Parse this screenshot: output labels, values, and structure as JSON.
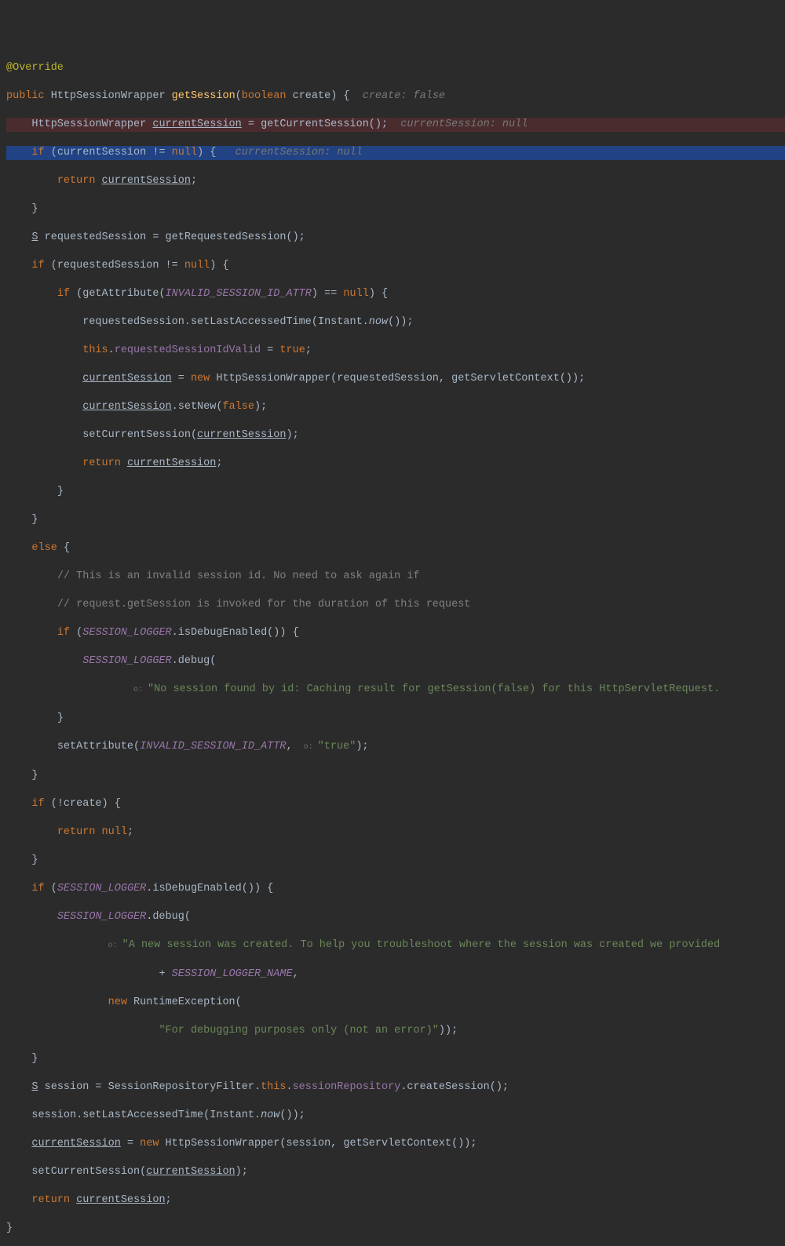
{
  "code": {
    "l1": {
      "anno": "@Override"
    },
    "l2": {
      "kw1": "public ",
      "type": "HttpSessionWrapper ",
      "method": "getSession",
      "p1": "(",
      "kw2": "boolean ",
      "p2": "create) {",
      "hint": "  create: false"
    },
    "l3": {
      "indent": "    ",
      "t1": "HttpSessionWrapper ",
      "u1": "currentSession",
      "t2": " = getCurrentSession();",
      "hint": "  currentSession: null"
    },
    "l4": {
      "indent": "    ",
      "kw": "if ",
      "t1": "(currentSession != ",
      "kw2": "null",
      "t2": ") {",
      "hint": "   currentSession: null"
    },
    "l5": {
      "indent": "        ",
      "kw": "return ",
      "u": "currentSession",
      "t": ";"
    },
    "l6": {
      "indent": "    ",
      "t": "}"
    },
    "l7": {
      "indent": "    ",
      "u1": "S",
      "t1": " requestedSession = getRequestedSession();"
    },
    "l8": {
      "indent": "    ",
      "kw": "if ",
      "t": "(requestedSession != ",
      "kw2": "null",
      "t2": ") {"
    },
    "l9": {
      "indent": "        ",
      "kw": "if ",
      "t1": "(getAttribute(",
      "c": "INVALID_SESSION_ID_ATTR",
      "t2": ") == ",
      "kw2": "null",
      "t3": ") {"
    },
    "l10": {
      "indent": "            ",
      "t1": "requestedSession.setLastAccessedTime(Instant.",
      "i": "now",
      "t2": "());"
    },
    "l11": {
      "indent": "            ",
      "kw": "this",
      "t1": ".",
      "f": "requestedSessionIdValid",
      "t2": " = ",
      "kw2": "true",
      "t3": ";"
    },
    "l12": {
      "indent": "            ",
      "u": "currentSession",
      "t1": " = ",
      "kw": "new ",
      "t2": "HttpSessionWrapper(requestedSession, getServletContext());"
    },
    "l13": {
      "indent": "            ",
      "u": "currentSession",
      "t1": ".setNew(",
      "kw": "false",
      "t2": ");"
    },
    "l14": {
      "indent": "            ",
      "t1": "setCurrentSession(",
      "u": "currentSession",
      "t2": ");"
    },
    "l15": {
      "indent": "            ",
      "kw": "return ",
      "u": "currentSession",
      "t": ";"
    },
    "l16": {
      "indent": "        ",
      "t": "}"
    },
    "l17": {
      "indent": "    ",
      "t": "}"
    },
    "l18": {
      "indent": "    ",
      "kw": "else ",
      "t": "{"
    },
    "l19": {
      "indent": "        ",
      "c": "// This is an invalid session id. No need to ask again if"
    },
    "l20": {
      "indent": "        ",
      "c": "// request.getSession is invoked for the duration of this request"
    },
    "l21": {
      "indent": "        ",
      "kw": "if ",
      "t1": "(",
      "c": "SESSION_LOGGER",
      "t2": ".isDebugEnabled()) {"
    },
    "l22": {
      "indent": "            ",
      "c": "SESSION_LOGGER",
      "t": ".debug("
    },
    "l23": {
      "indent": "                    ",
      "lbl": "o: ",
      "s": "\"No session found by id: Caching result for getSession(false) for this HttpServletRequest."
    },
    "l24": {
      "indent": "        ",
      "t": "}"
    },
    "l25": {
      "indent": "        ",
      "t1": "setAttribute(",
      "c": "INVALID_SESSION_ID_ATTR",
      "t2": ", ",
      "lbl": " o: ",
      "s": "\"true\"",
      "t3": ");"
    },
    "l26": {
      "indent": "    ",
      "t": "}"
    },
    "l27": {
      "indent": "    ",
      "kw": "if ",
      "t": "(!create) {"
    },
    "l28": {
      "indent": "        ",
      "kw": "return null",
      "t": ";"
    },
    "l29": {
      "indent": "    ",
      "t": "}"
    },
    "l30": {
      "indent": "    ",
      "kw": "if ",
      "t1": "(",
      "c": "SESSION_LOGGER",
      "t2": ".isDebugEnabled()) {"
    },
    "l31": {
      "indent": "        ",
      "c": "SESSION_LOGGER",
      "t": ".debug("
    },
    "l32": {
      "indent": "                ",
      "lbl": "o: ",
      "s": "\"A new session was created. To help you troubleshoot where the session was created we provided"
    },
    "l33": {
      "indent": "                        ",
      "t": "+ ",
      "c": "SESSION_LOGGER_NAME",
      "t2": ","
    },
    "l34": {
      "indent": "                ",
      "kw": "new ",
      "t": "RuntimeException("
    },
    "l35": {
      "indent": "                        ",
      "s": "\"For debugging purposes only (not an error)\"",
      "t": "));"
    },
    "l36": {
      "indent": "    ",
      "t": "}"
    },
    "l37": {
      "indent": "    ",
      "u": "S",
      "t1": " session = SessionRepositoryFilter.",
      "kw": "this",
      "t2": ".",
      "f": "sessionRepository",
      "t3": ".createSession();"
    },
    "l38": {
      "indent": "    ",
      "t1": "session.setLastAccessedTime(Instant.",
      "i": "now",
      "t2": "());"
    },
    "l39": {
      "indent": "    ",
      "u": "currentSession",
      "t1": " = ",
      "kw": "new ",
      "t2": "HttpSessionWrapper(session, getServletContext());"
    },
    "l40": {
      "indent": "    ",
      "t1": "setCurrentSession(",
      "u": "currentSession",
      "t2": ");"
    },
    "l41": {
      "indent": "    ",
      "kw": "return ",
      "u": "currentSession",
      "t": ";"
    },
    "l42": {
      "t": "}"
    }
  }
}
